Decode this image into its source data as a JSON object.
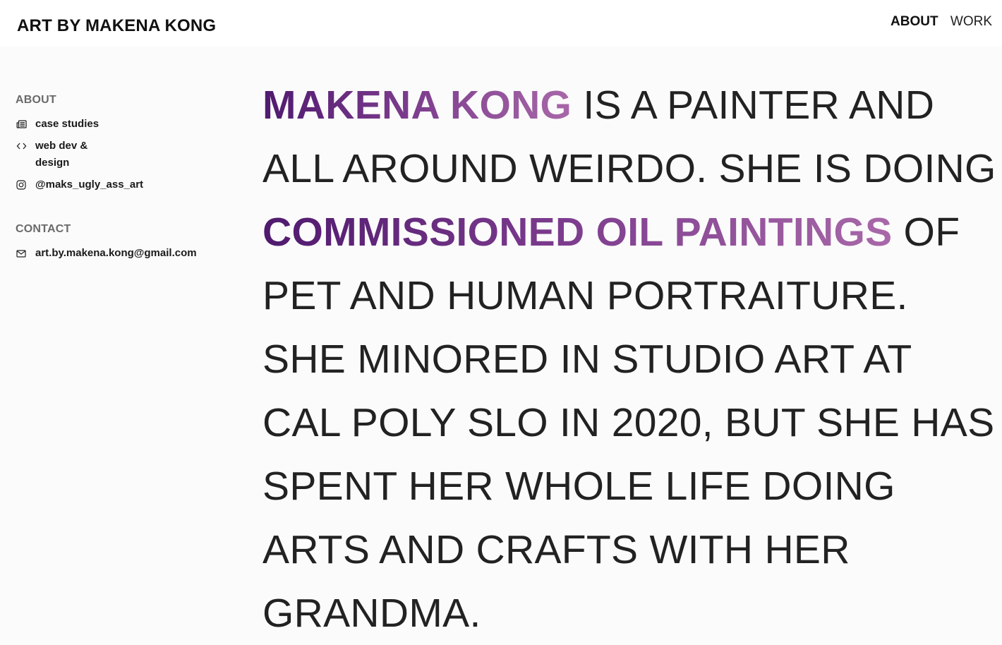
{
  "header": {
    "title": "ART BY MAKENA KONG",
    "nav": [
      {
        "label": "ABOUT",
        "active": true
      },
      {
        "label": "WORK",
        "active": false
      }
    ]
  },
  "sidebar": {
    "about": {
      "heading": "ABOUT",
      "links": [
        {
          "label": "case studies",
          "icon": "newspaper-icon"
        },
        {
          "label": "web dev & design",
          "icon": "code-icon"
        },
        {
          "label": "@maks_ugly_ass_art",
          "icon": "instagram-icon"
        }
      ]
    },
    "contact": {
      "heading": "CONTACT",
      "links": [
        {
          "label": "art.by.makena.kong@gmail.com",
          "icon": "mail-icon"
        }
      ]
    }
  },
  "hero": {
    "highlight_name": "MAKENA KONG",
    "text_1": " IS A PAINTER AND ALL AROUND WEIRDO. SHE IS DOING ",
    "highlight_work": "COMMISSIONED OIL PAINTINGS",
    "text_2": " OF PET AND HUMAN PORTRAITURE. SHE MINORED IN STUDIO ART AT CAL POLY SLO IN 2020, BUT SHE HAS SPENT HER WHOLE LIFE DOING ARTS AND CRAFTS WITH HER GRANDMA."
  },
  "colors": {
    "gradient_start": "#4f1a6e",
    "gradient_end": "#a868a8",
    "text": "#222222",
    "heading_gray": "#6a6a6a"
  }
}
